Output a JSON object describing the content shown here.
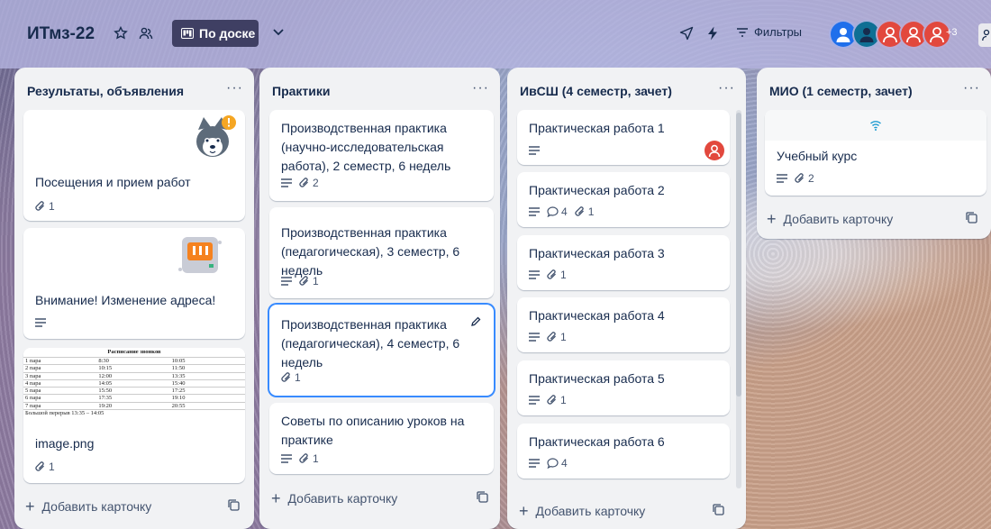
{
  "header": {
    "board_title": "ИТмз-22",
    "view_label": "По доске",
    "filters_label": "Фильтры",
    "members_extra": "+3"
  },
  "lists": [
    {
      "title": "Результаты, объявления",
      "cards": [
        {
          "title": "Посещения и прием работ",
          "attachments": "1"
        },
        {
          "title": "Внимание! Изменение адреса!"
        },
        {
          "title": "image.png",
          "attachments": "1",
          "schedule": {
            "title": "Расписание звонков",
            "rows": [
              [
                "1 пара",
                "8:30",
                "10:05"
              ],
              [
                "2 пара",
                "10:15",
                "11:50"
              ],
              [
                "3 пара",
                "12:00",
                "13:35"
              ],
              [
                "4 пара",
                "14:05",
                "15:40"
              ],
              [
                "5 пара",
                "15:50",
                "17:25"
              ],
              [
                "6 пара",
                "17:35",
                "19:10"
              ],
              [
                "7 пара",
                "19:20",
                "20:55"
              ]
            ],
            "footer": "Большой перерыв 13:35 – 14:05"
          }
        }
      ],
      "add_label": "Добавить карточку"
    },
    {
      "title": "Практики",
      "cards": [
        {
          "title": "Производственная практика (научно-исследовательская работа), 2 семестр, 6 недель",
          "attachments": "2"
        },
        {
          "title": "Производственная практика (педагогическая), 3 семестр, 6 недель",
          "attachments": "1"
        },
        {
          "title": "Производственная практика (педагогическая), 4 семестр, 6 недель",
          "attachments": "1"
        },
        {
          "title": "Советы по описанию уроков на практике",
          "attachments": "1"
        }
      ],
      "add_label": "Добавить карточку"
    },
    {
      "title": "ИвСШ (4 семестр, зачет)",
      "cards": [
        {
          "title": "Практическая работа 1"
        },
        {
          "title": "Практическая работа 2",
          "comments": "4",
          "attachments": "1"
        },
        {
          "title": "Практическая работа 3",
          "attachments": "1"
        },
        {
          "title": "Практическая работа 4",
          "attachments": "1"
        },
        {
          "title": "Практическая работа 5",
          "attachments": "1"
        },
        {
          "title": "Практическая работа 6",
          "comments": "4"
        }
      ],
      "add_label": "Добавить карточку"
    },
    {
      "title": "МИО (1 семестр, зачет)",
      "cards": [
        {
          "title": "Учебный курс",
          "attachments": "2"
        }
      ],
      "add_label": "Добавить карточку"
    }
  ],
  "colors": {
    "accent": "#388bff",
    "avatar_blue": "#1f6feb",
    "avatar_red": "#e2483d",
    "header_dark": "#3f3f63"
  }
}
